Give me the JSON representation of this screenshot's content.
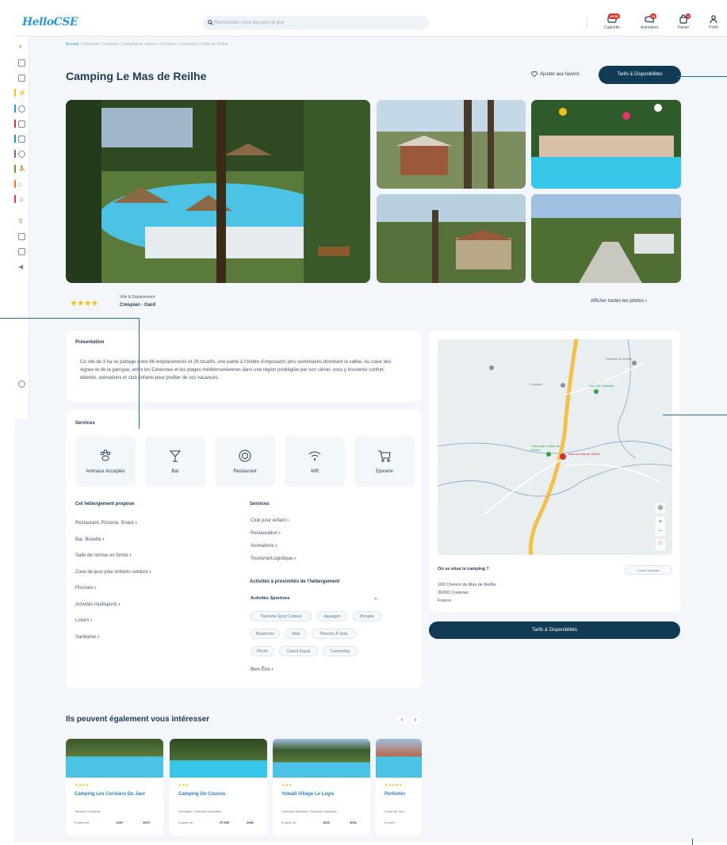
{
  "topbar": {
    "logo": "HelloCSE",
    "search_placeholder": "Recherchez votre lieu plus le jour",
    "items": [
      {
        "label": "Cagnotte",
        "badge": "1975€"
      },
      {
        "label": "Animation",
        "badge": "10"
      },
      {
        "label": "Panier",
        "badge": "0"
      },
      {
        "label": "Profil",
        "badge": ""
      }
    ]
  },
  "breadcrumb": [
    "Accueil",
    "Vacances",
    "Camping",
    "Camping en régions",
    "Occitanie",
    "Camping Le Mas de Reilhe"
  ],
  "page": {
    "title": "Camping Le Mas de Reilhe",
    "favorite_label": "Ajouter aux favoris",
    "tarifs_label": "Tarifs & Disponibilités",
    "stars": "★★★★",
    "ville_label": "Ville & Département",
    "ville_value": "Crespian - Gard",
    "all_photos_label": "Afficher toutes les photos"
  },
  "presentation": {
    "title": "Présentation",
    "text": "Ce site de 3 ha se partage entre 66 emplacements et 26 locatifs, une partie à l'ombre d'imposants pins centenaires dominant la vallée. Au cœur des vignes et de la garrigue, entre les Cévennes et les plages méditerranéennes dans une région privilégiée par son climat, vous y trouverez confort, détente, animations et club enfants pour profiter de vos vacances."
  },
  "services": {
    "title": "Services",
    "tiles": [
      {
        "label": "Animaux Acceptés",
        "icon": "paw-icon"
      },
      {
        "label": "Bar",
        "icon": "cocktail-icon"
      },
      {
        "label": "Restaurant",
        "icon": "plate-icon"
      },
      {
        "label": "Wifi",
        "icon": "wifi-icon"
      },
      {
        "label": "Epicerie",
        "icon": "cart-icon"
      }
    ],
    "hebergement_title": "Cet hébergement propose",
    "hebergement_items": [
      "Restaurant, Pizzeria, Snack",
      "Bar, Buvette",
      "Salle de remise en forme",
      "Zone de jeux pour enfants outdoor",
      "Piscines",
      "Activités multisports",
      "Loisirs",
      "Sanitaires"
    ],
    "services_title": "Services",
    "services_items": [
      "Club pour enfant",
      "Restauration",
      "Animations",
      "Tourisme/Logistique"
    ],
    "activities_title": "Activités à proximités de l'hébergement",
    "sport_title": "Activités Sportives",
    "chips": [
      "Tourisme Sport Culturel",
      "Aquagym",
      "Plongée",
      "Baudrome",
      "Voile",
      "Planche À Voile",
      "Pêche",
      "Canoë Kayak",
      "Canyoning"
    ],
    "bien_etre": "Bien Être"
  },
  "location": {
    "question": "Où se situe le camping ?",
    "copy_label": "Copier l'adresse",
    "address1": "169 Chemin du Mas de Reilhe",
    "address2": "30260 Crespian",
    "address3": "France",
    "map_labels": [
      "Mas du Mas de Reilhe",
      "Camping Le Mas de Reilhe",
      "Cave de Crespian",
      "Hameau de Reilhe",
      "Crespian"
    ],
    "tarifs_label": "Tarifs & Disponibilités"
  },
  "recommend": {
    "title": "Ils peuvent également vous intéresser",
    "cards": [
      {
        "stars": "★★★★",
        "title": "Camping Les Cerisiers Du Jaur",
        "loc": "Hérault | Occitanie",
        "from": "À partir de",
        "price": "113€",
        "points": "2876"
      },
      {
        "stars": "★★★",
        "title": "Camping Du Coucou",
        "loc": "Dordogne | Nouvelle-Aquitaine",
        "from": "À partir de",
        "price": "97,90€",
        "points": "2496"
      },
      {
        "stars": "★★★",
        "title": "Yukadi Village Le Logis",
        "loc": "Charente-Maritime | Nouvelle-Aquitaine",
        "from": "À partir de",
        "price": "161€",
        "points": "3051"
      },
      {
        "stars": "★★★★★",
        "title": "Perfumin",
        "loc": "Corse du Sud",
        "from": "À partir",
        "price": "",
        "points": ""
      }
    ]
  }
}
